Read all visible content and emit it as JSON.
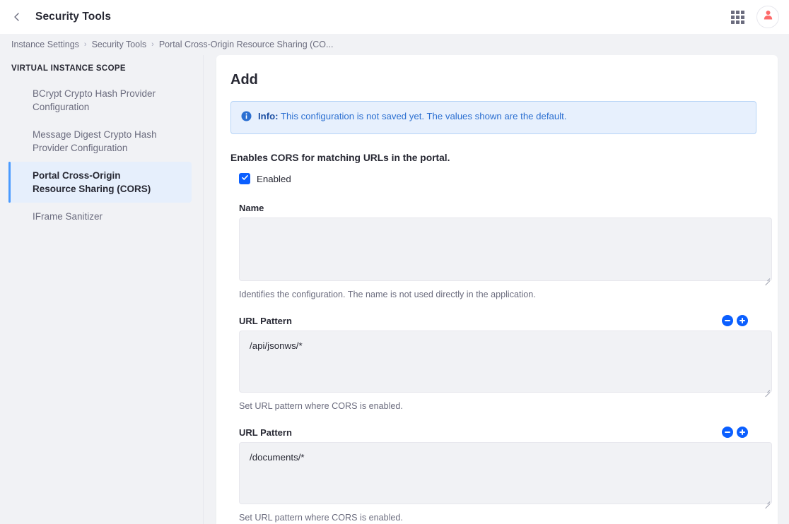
{
  "topbar": {
    "back_icon": "chevron-left-icon",
    "title": "Security Tools",
    "grid_icon": "app-grid-icon",
    "avatar_icon": "user-avatar-icon"
  },
  "breadcrumb": {
    "items": [
      {
        "label": "Instance Settings"
      },
      {
        "label": "Security Tools"
      },
      {
        "label": "Portal Cross-Origin Resource Sharing (CO..."
      }
    ],
    "separator": "›"
  },
  "sidebar": {
    "heading": "VIRTUAL INSTANCE SCOPE",
    "items": [
      {
        "label": "BCrypt Crypto Hash Provider Configuration",
        "active": false
      },
      {
        "label": "Message Digest Crypto Hash Provider Configuration",
        "active": false
      },
      {
        "label": "Portal Cross-Origin Resource Sharing (CORS)",
        "active": true
      },
      {
        "label": "IFrame Sanitizer",
        "active": false
      }
    ]
  },
  "main": {
    "title": "Add",
    "alert": {
      "icon": "info-circle-icon",
      "label": "Info:",
      "message": "This configuration is not saved yet. The values shown are the default."
    },
    "section_title": "Enables CORS for matching URLs in the portal.",
    "enabled_checkbox": {
      "label": "Enabled",
      "checked": true,
      "icon": "check-icon"
    },
    "fields": [
      {
        "label": "Name",
        "value": "",
        "help": "Identifies the configuration. The name is not used directly in the application.",
        "has_buttons": false
      },
      {
        "label": "URL Pattern",
        "value": "/api/jsonws/*",
        "help": "Set URL pattern where CORS is enabled.",
        "has_buttons": true,
        "remove_icon": "minus-circle-icon",
        "add_icon": "plus-circle-icon"
      },
      {
        "label": "URL Pattern",
        "value": "/documents/*",
        "help": "Set URL pattern where CORS is enabled.",
        "has_buttons": true,
        "remove_icon": "minus-circle-icon",
        "add_icon": "plus-circle-icon"
      }
    ]
  },
  "colors": {
    "accent": "#0b5fff",
    "active_nav_bar": "#4b9bff",
    "alert_bg": "#e7f0fd",
    "alert_text": "#2b6fd1",
    "page_bg": "#f1f2f5",
    "avatar": "#fd6a6a"
  }
}
